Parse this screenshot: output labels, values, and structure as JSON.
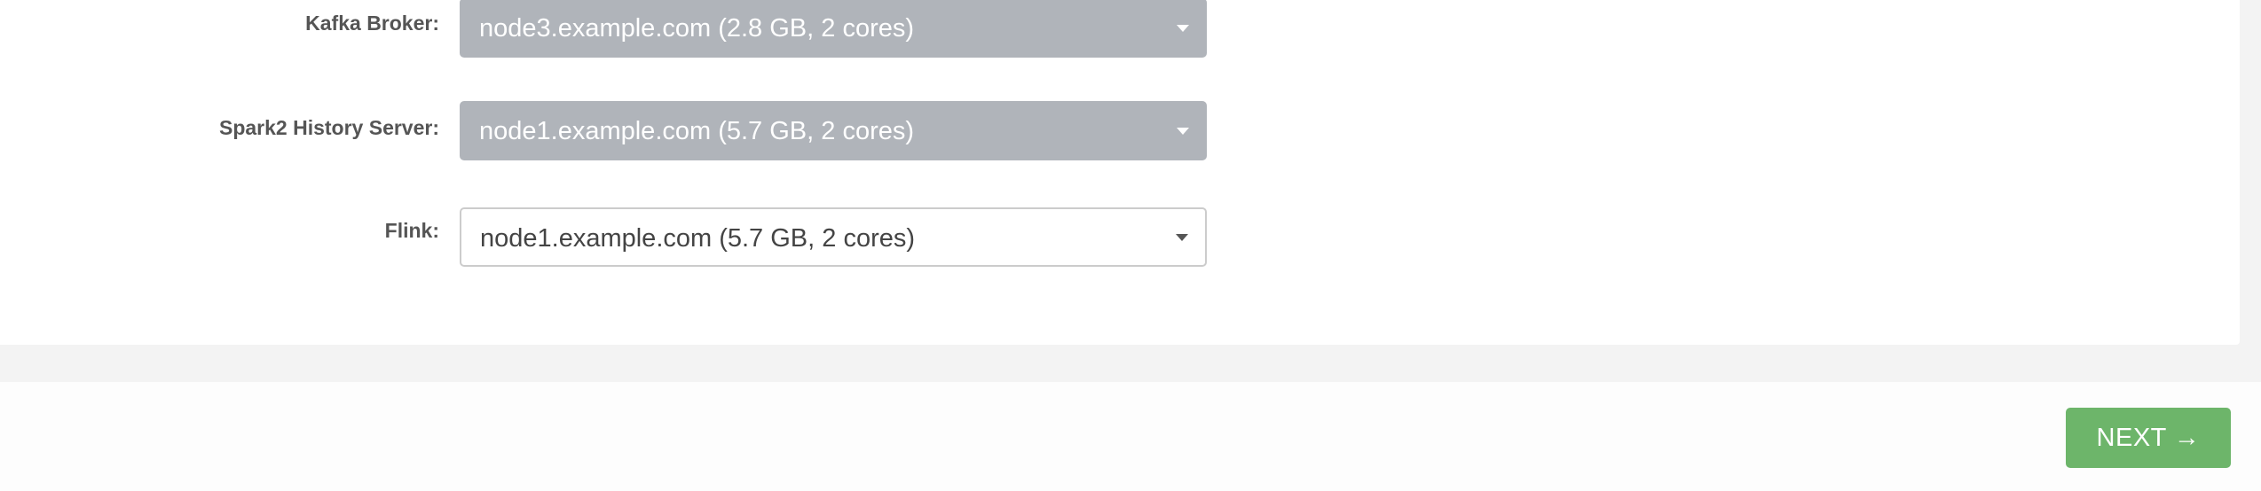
{
  "rows": [
    {
      "label": "Kafka Broker:",
      "value": "node3.example.com (2.8 GB, 2 cores)",
      "state": "disabled"
    },
    {
      "label": "Spark2 History Server:",
      "value": "node1.example.com (5.7 GB, 2 cores)",
      "state": "disabled"
    },
    {
      "label": "Flink:",
      "value": "node1.example.com (5.7 GB, 2 cores)",
      "state": "enabled"
    }
  ],
  "footer": {
    "next_label": "NEXT →"
  },
  "colors": {
    "disabled_select": "#b0b4ba",
    "next_button": "#6db56a"
  },
  "icons": {
    "select_caret": "caret-down-icon"
  }
}
